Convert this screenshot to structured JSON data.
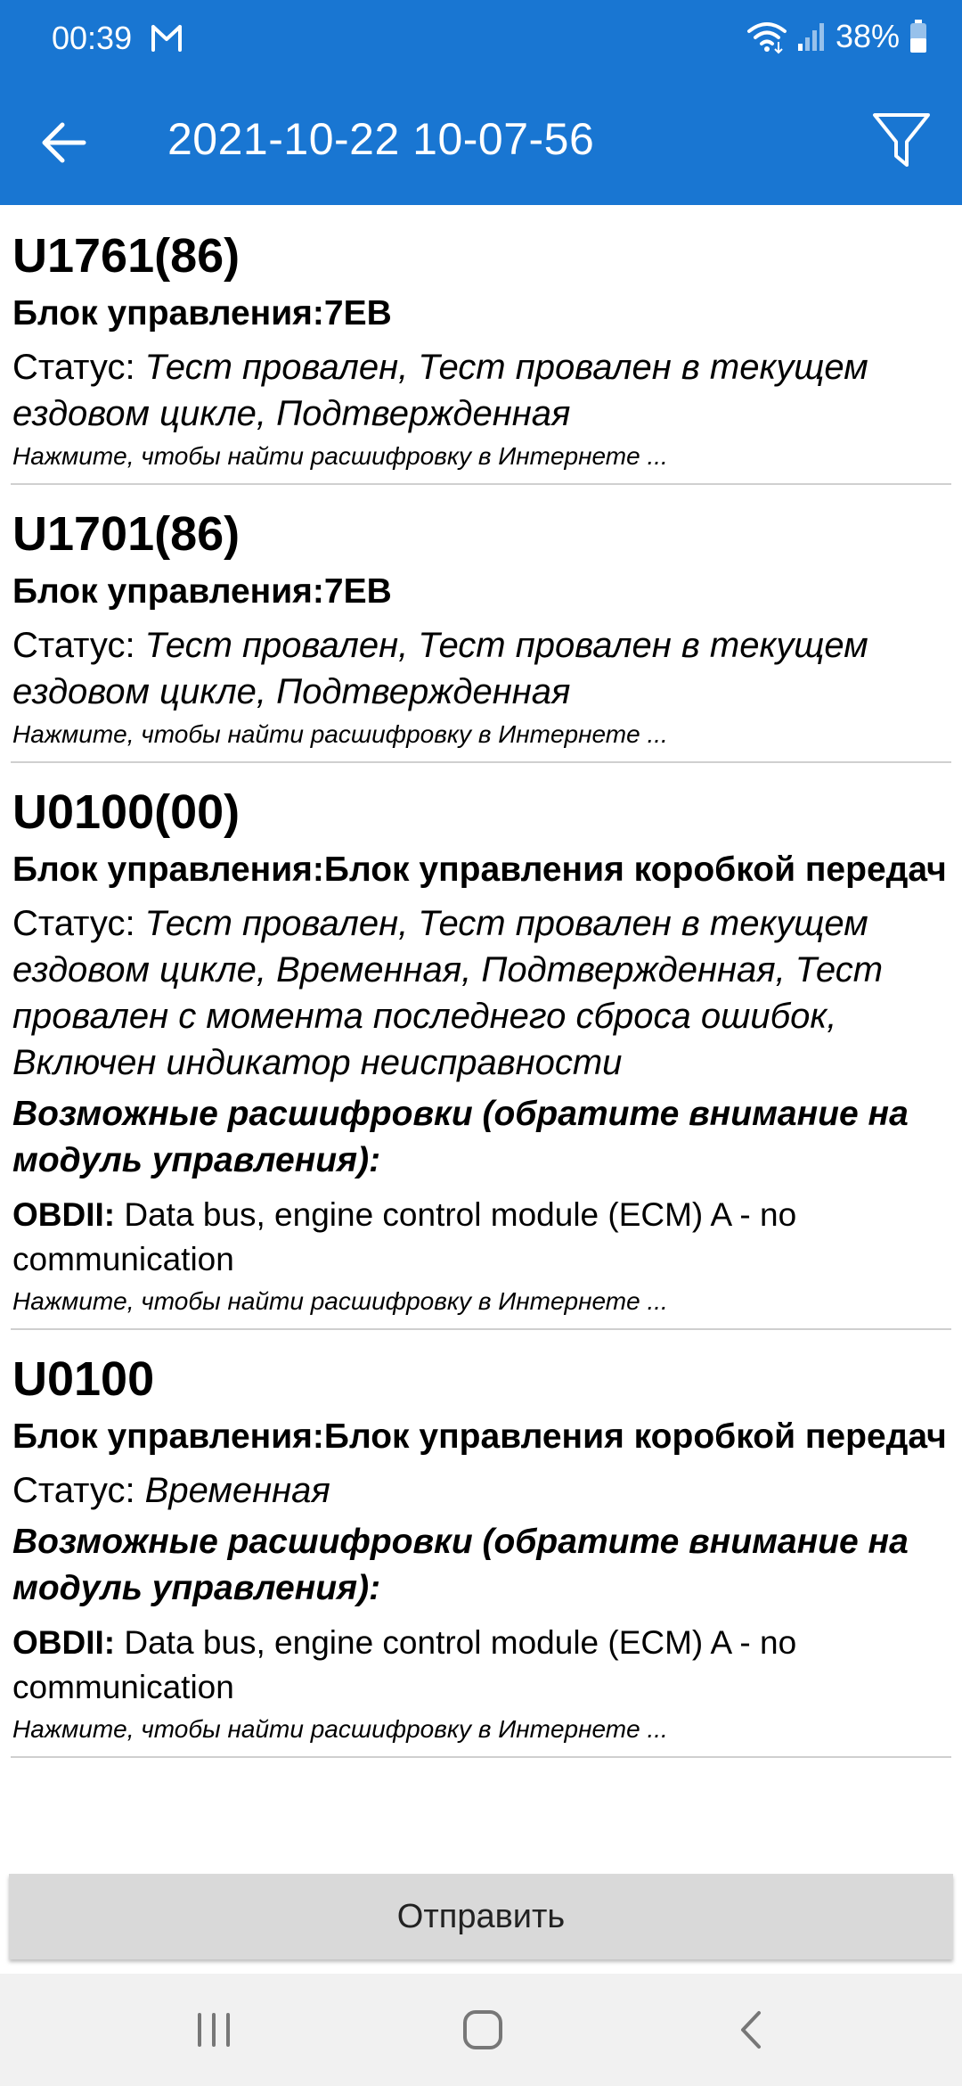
{
  "status_bar": {
    "time": "00:39",
    "battery": "38%"
  },
  "toolbar": {
    "title": "2021-10-22 10-07-56"
  },
  "items": [
    {
      "code": "U1761(86)",
      "block": "Блок управления:7EB",
      "status_label": "Статус: ",
      "status_value": "Тест провален, Тест провален в текущем ездовом цикле, Подтвержденная",
      "hint": "Нажмите, чтобы найти расшифровку в Интернете ..."
    },
    {
      "code": "U1701(86)",
      "block": "Блок управления:7EB",
      "status_label": "Статус: ",
      "status_value": "Тест провален, Тест провален в текущем ездовом цикле, Подтвержденная",
      "hint": "Нажмите, чтобы найти расшифровку в Интернете ..."
    },
    {
      "code": "U0100(00)",
      "block": "Блок управления:Блок управления коробкой передач",
      "status_label": "Статус: ",
      "status_value": "Тест провален, Тест провален в текущем ездовом цикле, Временная, Подтвержденная, Тест провален с момента последнего сброса ошибок, Включен индикатор неисправности",
      "possible": "Возможные расшифровки (обратите внимание на модуль управления):",
      "decode_source": "OBDII:",
      "decode_text": " Data bus, engine control module (ECM) A - no communication",
      "hint": "Нажмите, чтобы найти расшифровку в Интернете ..."
    },
    {
      "code": "U0100",
      "block": "Блок управления:Блок управления коробкой передач",
      "status_label": "Статус: ",
      "status_value": "Временная",
      "possible": "Возможные расшифровки (обратите внимание на модуль управления):",
      "decode_source": "OBDII:",
      "decode_text": " Data bus, engine control module (ECM) A - no communication",
      "hint": "Нажмите, чтобы найти расшифровку в Интернете ..."
    }
  ],
  "send_button": {
    "label": "Отправить"
  },
  "icons": {
    "status": [
      "gmail-icon",
      "wifi-icon",
      "signal-icon",
      "battery-icon"
    ],
    "toolbar": [
      "back-arrow-icon",
      "filter-icon"
    ],
    "nav": [
      "recents-icon",
      "home-icon",
      "back-icon"
    ]
  },
  "colors": {
    "appbar": "#1976d2",
    "divider": "#cfcfcf",
    "button": "#d9d9d9",
    "navbar": "#f1f1f1"
  }
}
